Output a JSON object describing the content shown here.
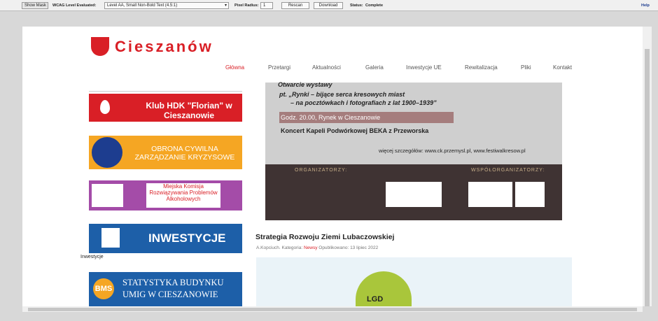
{
  "toolbar": {
    "show_mask": "Show Mask",
    "wcag_label": "WCAG Level Evaluated:",
    "wcag_value": "Level AA, Small Non-Bold Text (4.5:1)",
    "radius_label": "Pixel Radius:",
    "radius_value": "1",
    "rescan": "Rescan",
    "download": "Download",
    "status_label": "Status:",
    "status_value": "Complete",
    "help": "Help"
  },
  "site": {
    "logo": "Cieszanów",
    "nav": [
      "Główna",
      "Przetargi",
      "Aktualności",
      "Galeria",
      "Inwestycje UE",
      "Rewitalizacja",
      "Pliki",
      "Kontakt"
    ]
  },
  "banners": {
    "klub": "Klub HDK \"Florian\" w Cieszanowie",
    "obrona": "OBRONA CYWILNA ZARZĄDZANIE KRYZYSOWE",
    "komisja": "Miejska Komisja Rozwiązywania Problemów Alkoholowych",
    "inwest": "INWESTYCJE",
    "inwest_caption": "Inwestycje",
    "stat": "STATYSTYKA BUDYNKU UMIG W CIESZANOWIE",
    "bms": "BMS"
  },
  "poster": {
    "l1": "Otwarcie wystawy",
    "l2": "pt. „Rynki – bijące serca kresowych miast",
    "l3": "– na pocztówkach i fotografiach z lat 1900–1939”",
    "l4": "Godz. 20.00, Rynek w Cieszanowie",
    "l5": "Koncert Kapeli Podwórkowej BEKA z Przeworska",
    "l6": "więcej szczegółów: www.ck.przemysl.pl, www.festiwalkresow.pl",
    "org": "ORGANIZATORZY:",
    "wsp": "WSPÓŁORGANIZATORZY:"
  },
  "article": {
    "title": "Strategia Rozwoju Ziemi Lubaczowskiej",
    "meta1": "A.Kopciuch. Kategoria:",
    "category": "Newsy",
    "meta2": "Opublikowano: 13 lipiec 2022",
    "lgd": "LGD"
  },
  "colors": {
    "red": "#d91f26",
    "orange": "#f5a623",
    "purple": "#a44ca8",
    "navy": "#1d3d8f"
  }
}
